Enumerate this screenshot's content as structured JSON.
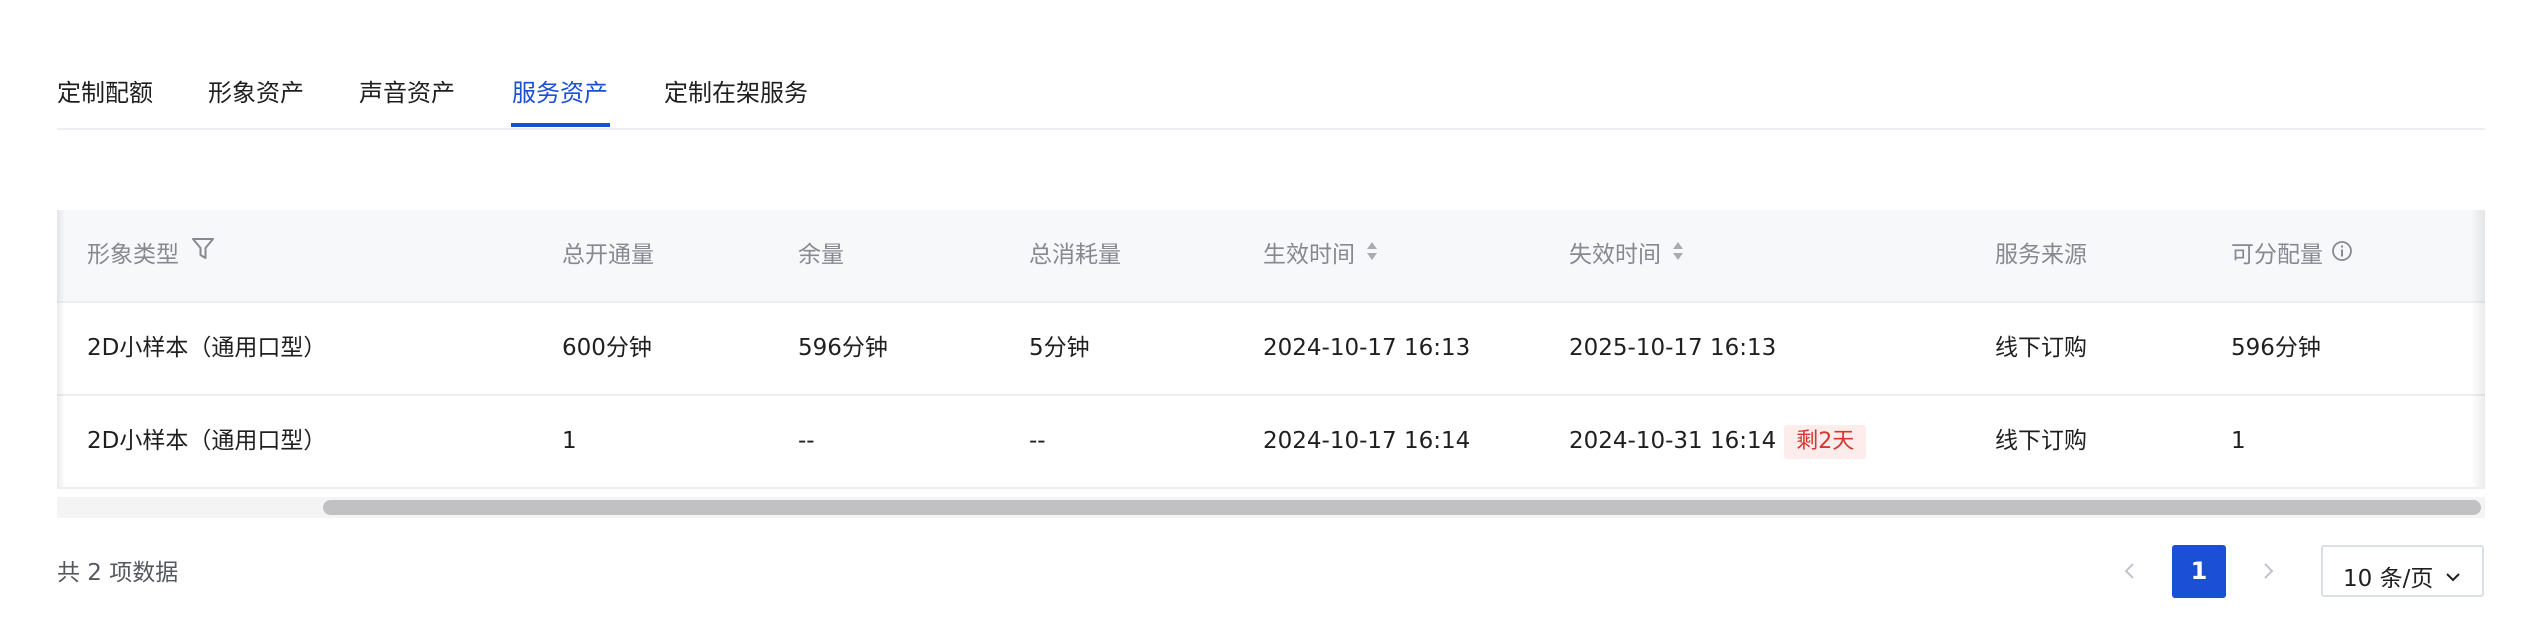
{
  "tabs": [
    {
      "label": "定制配额",
      "active": false
    },
    {
      "label": "形象资产",
      "active": false
    },
    {
      "label": "声音资产",
      "active": false
    },
    {
      "label": "服务资产",
      "active": true
    },
    {
      "label": "定制在架服务",
      "active": false
    }
  ],
  "table": {
    "columns": [
      "形象类型",
      "总开通量",
      "余量",
      "总消耗量",
      "生效时间",
      "失效时间",
      "服务来源",
      "可分配量"
    ],
    "rows": [
      {
        "type": "2D小样本（通用口型）",
        "total": "600分钟",
        "remaining": "596分钟",
        "consumed": "5分钟",
        "start": "2024-10-17 16:13",
        "end": "2025-10-17 16:13",
        "tag": "",
        "source": "线下订购",
        "allocatable": "596分钟"
      },
      {
        "type": "2D小样本（通用口型）",
        "total": "1",
        "remaining": "--",
        "consumed": "--",
        "start": "2024-10-17 16:14",
        "end": "2024-10-31 16:14",
        "tag": "剩2天",
        "source": "线下订购",
        "allocatable": "1"
      }
    ]
  },
  "pagination": {
    "total_text": "共 2 项数据",
    "current_page": "1",
    "page_size": "10 条/页"
  },
  "icons": {
    "filter": "filter-icon",
    "sort": "sort-icon",
    "info": "info-icon",
    "prev": "chevron-left-icon",
    "next": "chevron-right-icon",
    "dropdown": "chevron-down-icon"
  },
  "colors": {
    "accent": "#1a4fd6",
    "tag_bg": "#fdecec",
    "tag_text": "#d4372f",
    "header_text": "#86898f"
  }
}
